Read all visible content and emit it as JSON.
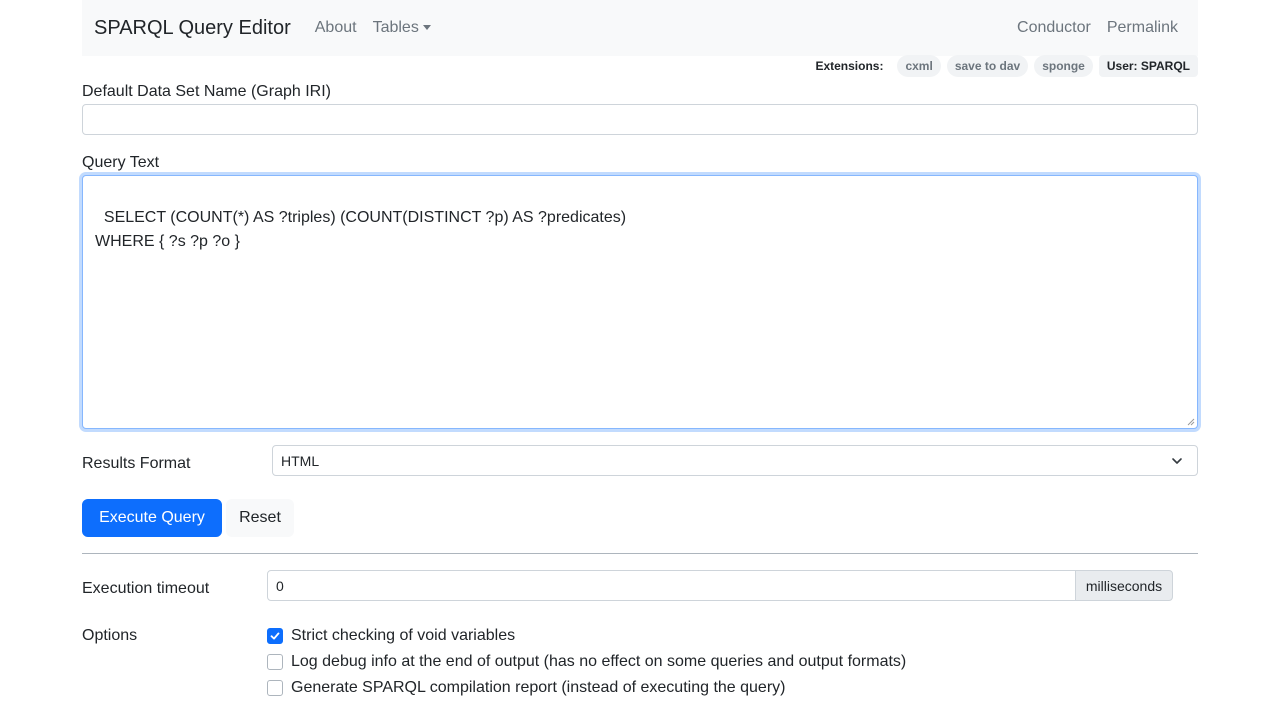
{
  "navbar": {
    "brand": "SPARQL Query Editor",
    "links": [
      "About",
      "Tables"
    ],
    "right_links": [
      "Conductor",
      "Permalink"
    ]
  },
  "extensions": {
    "label": "Extensions:",
    "items": [
      "cxml",
      "save to dav",
      "sponge"
    ],
    "user": "User: SPARQL"
  },
  "form": {
    "graph_label": "Default Data Set Name (Graph IRI)",
    "graph_value": "",
    "query_label": "Query Text",
    "query_text": "SELECT (COUNT(*) AS ?triples) (COUNT(DISTINCT ?p) AS ?predicates)\nWHERE { ?s ?p ?o }",
    "results_format_label": "Results Format",
    "results_format_value": "HTML",
    "execute_label": "Execute Query",
    "reset_label": "Reset",
    "timeout_label": "Execution timeout",
    "timeout_value": "0",
    "timeout_unit": "milliseconds",
    "options_label": "Options",
    "options": [
      {
        "label": "Strict checking of void variables",
        "checked": true
      },
      {
        "label": "Log debug info at the end of output (has no effect on some queries and output formats)",
        "checked": false
      },
      {
        "label": "Generate SPARQL compilation report (instead of executing the query)",
        "checked": false
      }
    ]
  },
  "colors": {
    "primary": "#0d6efd",
    "navbar_bg": "#f8f9fa",
    "muted_text": "#6c757d"
  }
}
